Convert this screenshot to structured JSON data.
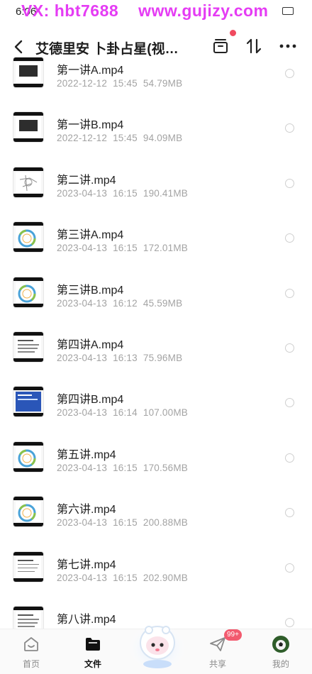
{
  "status_bar": {
    "time": "6:06"
  },
  "watermark": {
    "left": "VX: hbt7688",
    "right": "www.gujizy.com"
  },
  "header": {
    "title": "艾德里安 卜卦占星(视频…"
  },
  "files": [
    {
      "name": "第一讲A.mp4",
      "date": "2022-12-12",
      "time": "15:45",
      "size": "54.79MB",
      "thumb": "dark-slide"
    },
    {
      "name": "第一讲B.mp4",
      "date": "2022-12-12",
      "time": "15:45",
      "size": "94.09MB",
      "thumb": "dark-slide"
    },
    {
      "name": "第二讲.mp4",
      "date": "2023-04-13",
      "time": "16:15",
      "size": "190.41MB",
      "thumb": "sketch"
    },
    {
      "name": "第三讲A.mp4",
      "date": "2023-04-13",
      "time": "16:15",
      "size": "172.01MB",
      "thumb": "chart-wheel"
    },
    {
      "name": "第三讲B.mp4",
      "date": "2023-04-13",
      "time": "16:12",
      "size": "45.59MB",
      "thumb": "chart-wheel"
    },
    {
      "name": "第四讲A.mp4",
      "date": "2023-04-13",
      "time": "16:13",
      "size": "75.96MB",
      "thumb": "text-doc"
    },
    {
      "name": "第四讲B.mp4",
      "date": "2023-04-13",
      "time": "16:14",
      "size": "107.00MB",
      "thumb": "blue-slide"
    },
    {
      "name": "第五讲.mp4",
      "date": "2023-04-13",
      "time": "16:15",
      "size": "170.56MB",
      "thumb": "chart-wheel"
    },
    {
      "name": "第六讲.mp4",
      "date": "2023-04-13",
      "time": "16:15",
      "size": "200.88MB",
      "thumb": "chart-wheel"
    },
    {
      "name": "第七讲.mp4",
      "date": "2023-04-13",
      "time": "16:15",
      "size": "202.90MB",
      "thumb": "text-doc"
    },
    {
      "name": "第八讲.mp4",
      "date": "",
      "time": "",
      "size": "",
      "thumb": "text-doc"
    }
  ],
  "bottom_nav": {
    "items": [
      {
        "label": "首页",
        "icon": "home-icon"
      },
      {
        "label": "文件",
        "icon": "folder-icon"
      },
      {
        "label": "共享",
        "icon": "share-icon"
      },
      {
        "label": "我的",
        "icon": "avatar-icon"
      }
    ],
    "share_badge": "99+"
  },
  "colors": {
    "accent": "#f04a5f",
    "watermark": "#e53cf4",
    "meta_text": "#a3a3a3"
  }
}
